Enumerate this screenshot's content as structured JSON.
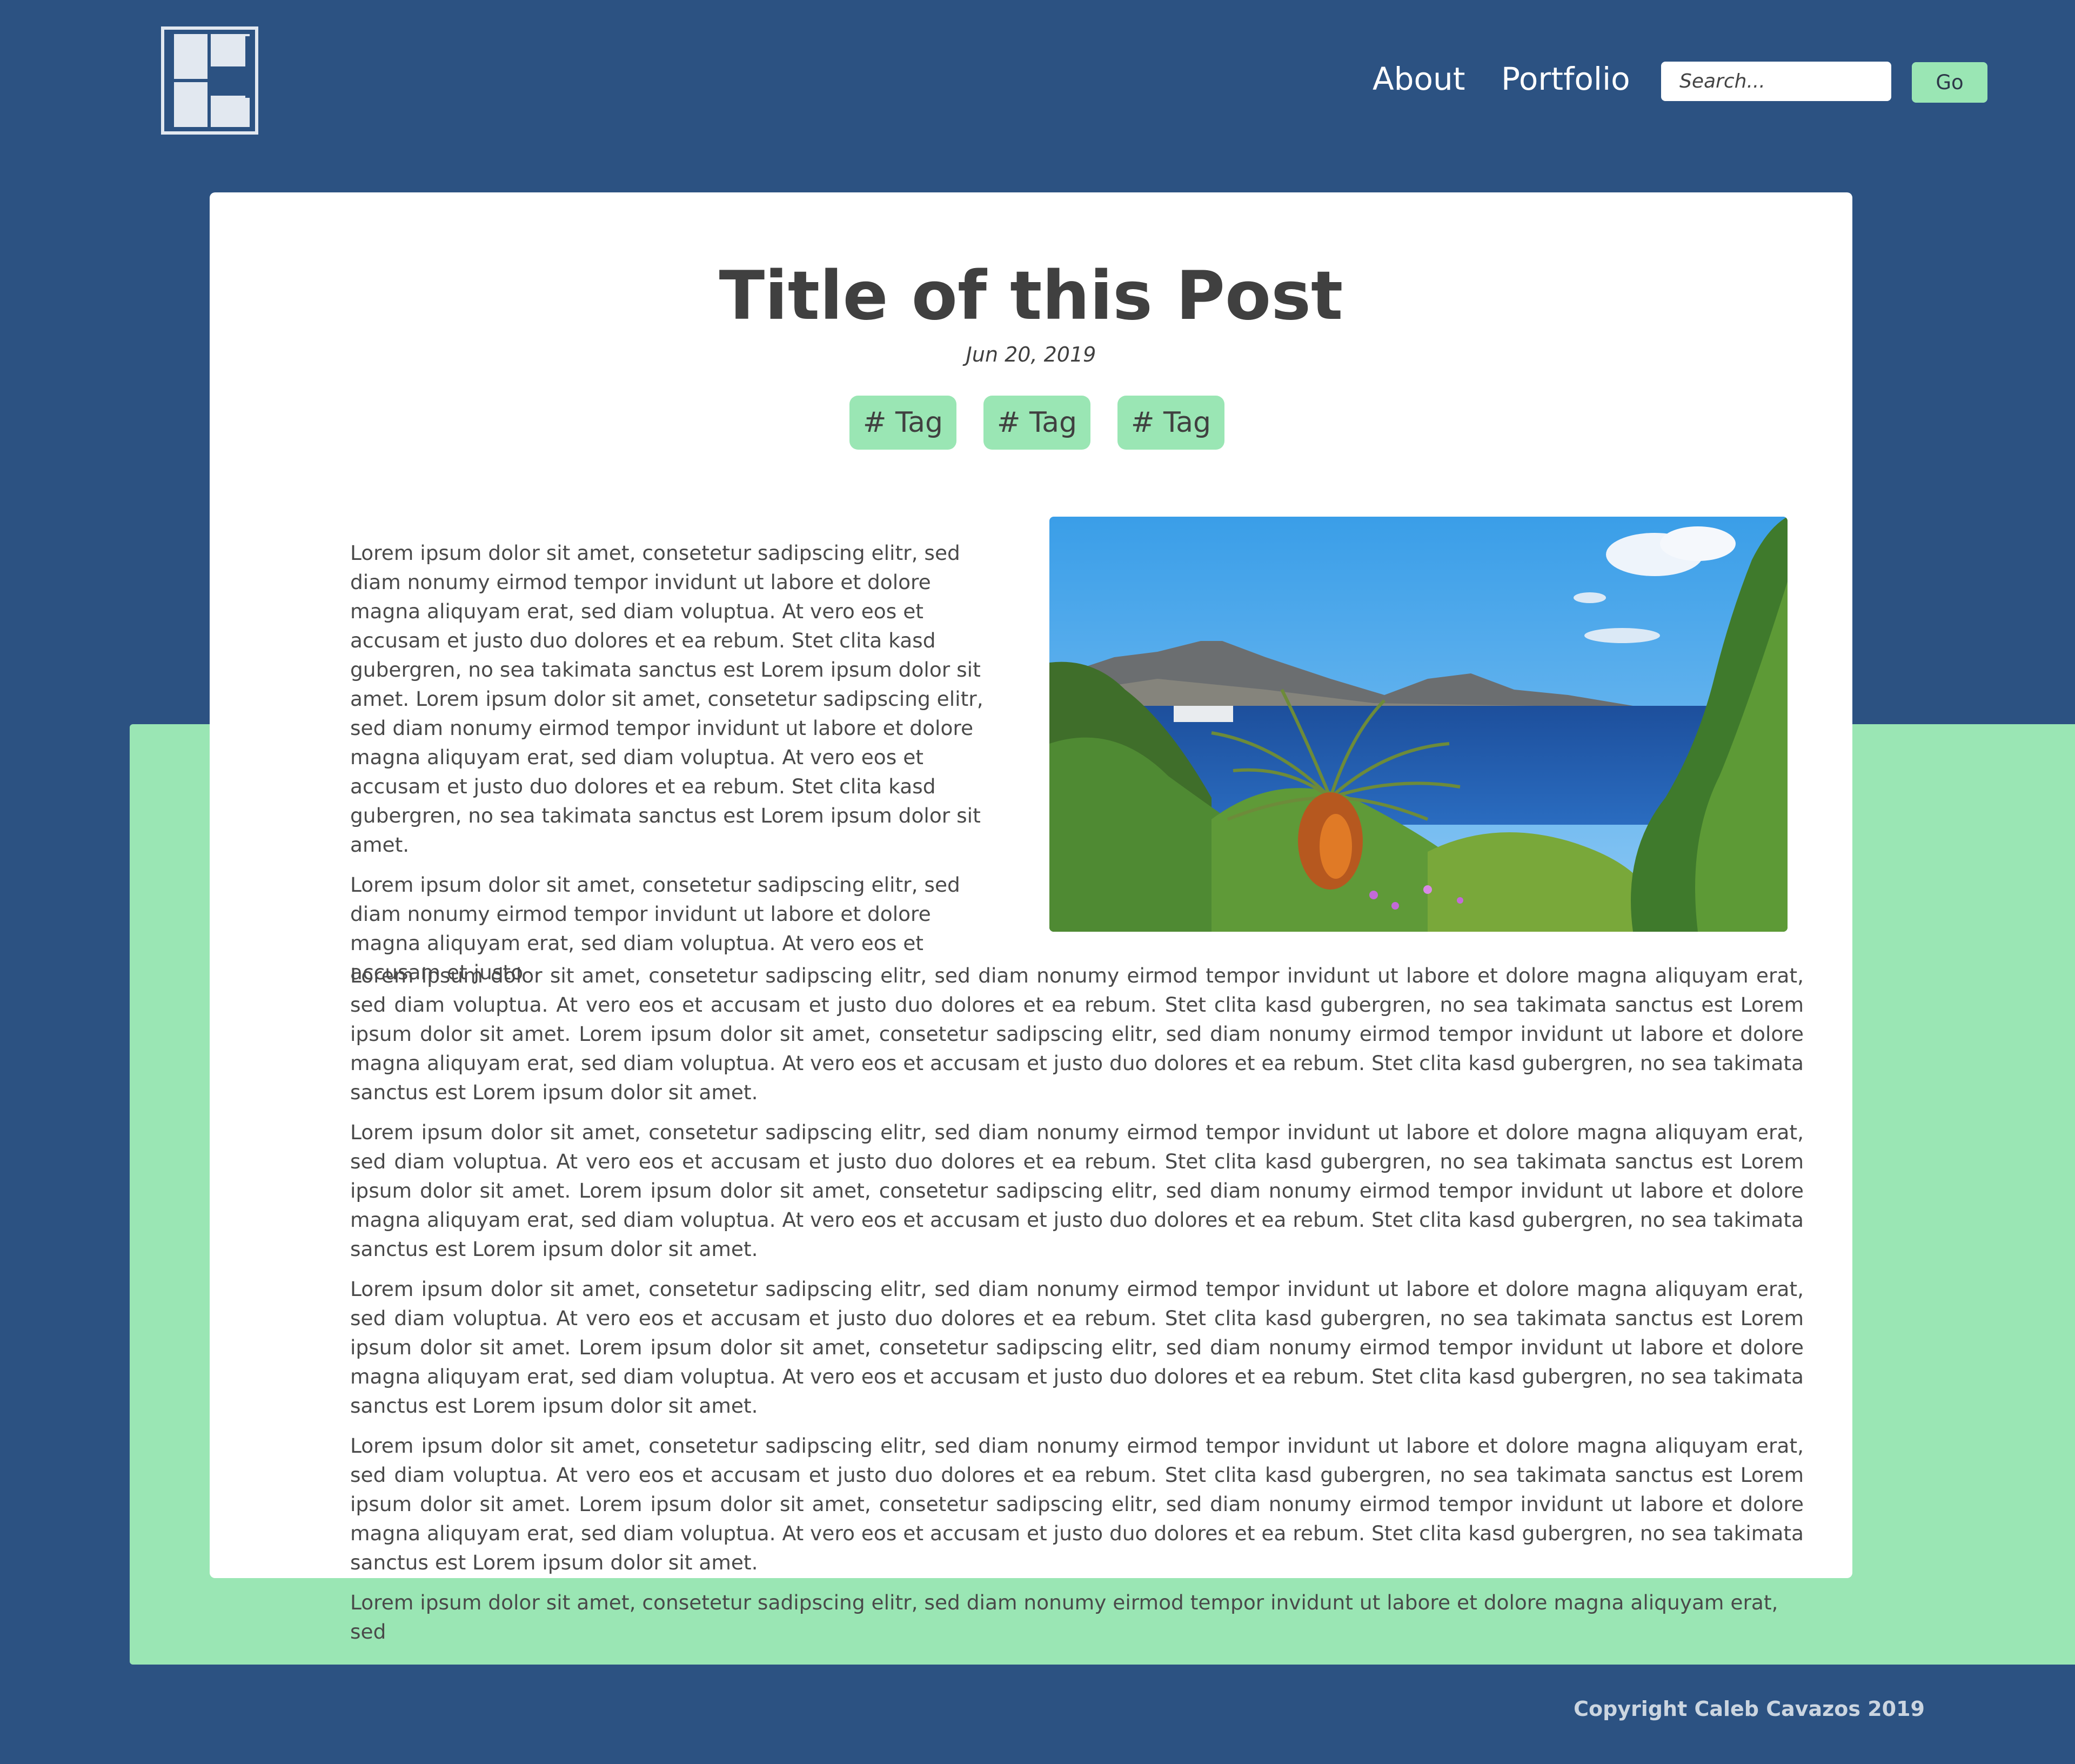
{
  "header": {
    "logo": "C",
    "nav": [
      "About",
      "Portfolio"
    ],
    "search": {
      "placeholder": "Search...",
      "button": "Go"
    }
  },
  "post": {
    "title": "Title of this Post",
    "date": "Jun 20, 2019",
    "tags": [
      "# Tag",
      "# Tag",
      "# Tag"
    ],
    "intro_paragraphs": [
      "Lorem ipsum dolor sit amet, consetetur sadipscing elitr, sed diam nonumy eirmod tempor invidunt ut labore et dolore magna aliquyam erat, sed diam voluptua. At vero eos et accusam et justo duo dolores et ea rebum. Stet clita kasd gubergren, no sea takimata sanctus est Lorem ipsum dolor sit amet. Lorem ipsum dolor sit amet, consetetur sadipscing elitr, sed diam nonumy eirmod tempor invidunt ut labore et dolore magna aliquyam erat, sed diam voluptua. At vero eos et accusam et justo duo dolores et ea rebum. Stet clita kasd gubergren, no sea takimata sanctus est Lorem ipsum dolor sit amet.",
      "Lorem ipsum dolor sit amet, consetetur sadipscing elitr, sed diam nonumy eirmod tempor invidunt ut labore et dolore magna aliquyam erat, sed diam voluptua. At vero eos et accusam et justo"
    ],
    "body_paragraphs": [
      "Lorem ipsum dolor sit amet, consetetur sadipscing elitr, sed diam nonumy eirmod tempor invidunt ut labore et dolore magna aliquyam erat, sed diam voluptua. At vero eos et accusam et justo duo dolores et ea rebum. Stet clita kasd gubergren, no sea takimata sanctus est Lorem ipsum dolor sit amet. Lorem ipsum dolor sit amet, consetetur sadipscing elitr, sed diam nonumy eirmod tempor invidunt ut labore et dolore magna aliquyam erat, sed diam voluptua. At vero eos et accusam et justo duo dolores et ea rebum. Stet clita kasd gubergren, no sea takimata sanctus est Lorem ipsum dolor sit amet.",
      "Lorem ipsum dolor sit amet, consetetur sadipscing elitr, sed diam nonumy eirmod tempor invidunt ut labore et dolore magna aliquyam erat, sed diam voluptua. At vero eos et accusam et justo duo dolores et ea rebum. Stet clita kasd gubergren, no sea takimata sanctus est Lorem ipsum dolor sit amet. Lorem ipsum dolor sit amet, consetetur sadipscing elitr, sed diam nonumy eirmod tempor invidunt ut labore et dolore magna aliquyam erat, sed diam voluptua. At vero eos et accusam et justo duo dolores et ea rebum. Stet clita kasd gubergren, no sea takimata sanctus est Lorem ipsum dolor sit amet.",
      "Lorem ipsum dolor sit amet, consetetur sadipscing elitr, sed diam nonumy eirmod tempor invidunt ut labore et dolore magna aliquyam erat, sed diam voluptua. At vero eos et accusam et justo duo dolores et ea rebum. Stet clita kasd gubergren, no sea takimata sanctus est Lorem ipsum dolor sit amet. Lorem ipsum dolor sit amet, consetetur sadipscing elitr, sed diam nonumy eirmod tempor invidunt ut labore et dolore magna aliquyam erat, sed diam voluptua. At vero eos et accusam et justo duo dolores et ea rebum. Stet clita kasd gubergren, no sea takimata sanctus est Lorem ipsum dolor sit amet.",
      "Lorem ipsum dolor sit amet, consetetur sadipscing elitr, sed diam nonumy eirmod tempor invidunt ut labore et dolore magna aliquyam erat, sed diam voluptua. At vero eos et accusam et justo duo dolores et ea rebum. Stet clita kasd gubergren, no sea takimata sanctus est Lorem ipsum dolor sit amet. Lorem ipsum dolor sit amet, consetetur sadipscing elitr, sed diam nonumy eirmod tempor invidunt ut labore et dolore magna aliquyam erat, sed diam voluptua. At vero eos et accusam et justo duo dolores et ea rebum. Stet clita kasd gubergren, no sea takimata sanctus est Lorem ipsum dolor sit amet.",
      "Lorem ipsum dolor sit amet, consetetur sadipscing elitr, sed diam nonumy eirmod tempor invidunt ut labore et dolore magna aliquyam erat, sed"
    ]
  },
  "footer": {
    "copyright": "Copyright Caleb Cavazos 2019"
  },
  "colors": {
    "background": "#2c5282",
    "accent": "#9ae6b4",
    "card": "#ffffff",
    "text": "#4a4a4a"
  }
}
